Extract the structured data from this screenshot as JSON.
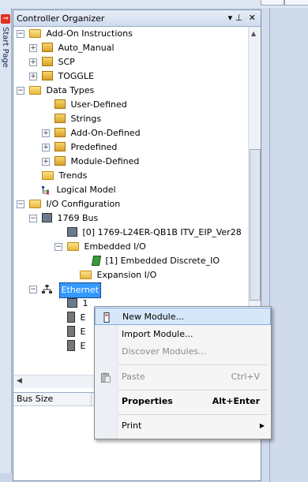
{
  "sidetab": {
    "label": "Start Page"
  },
  "organizer": {
    "title": "Controller Organizer",
    "pin_glyph": "▾ ⊥",
    "close_glyph": "✕"
  },
  "tree": {
    "add_on_instructions": "Add-On Instructions",
    "auto_manual": "Auto_Manual",
    "scp": "SCP",
    "toggle": "TOGGLE",
    "data_types": "Data Types",
    "user_defined": "User-Defined",
    "strings": "Strings",
    "aoi_defined": "Add-On-Defined",
    "predefined": "Predefined",
    "module_defined": "Module-Defined",
    "trends": "Trends",
    "logical_model": "Logical Model",
    "io_config": "I/O Configuration",
    "bus": "1769 Bus",
    "controller": "[0] 1769-L24ER-QB1B ITV_EIP_Ver28",
    "embedded_io": "Embedded I/O",
    "embedded_discrete": "[1] Embedded Discrete_IO",
    "expansion_io": "Expansion I/O",
    "ethernet": "Ethernet",
    "eth_child1": "1",
    "eth_child2": "E",
    "eth_child3": "E",
    "eth_child4": "E"
  },
  "grid": {
    "column": "Bus Size"
  },
  "context_menu": {
    "new_module": "New Module...",
    "import_module": "Import Module...",
    "discover_modules": "Discover Modules...",
    "paste": "Paste",
    "paste_shortcut": "Ctrl+V",
    "properties": "Properties",
    "properties_shortcut": "Alt+Enter",
    "print": "Print"
  }
}
